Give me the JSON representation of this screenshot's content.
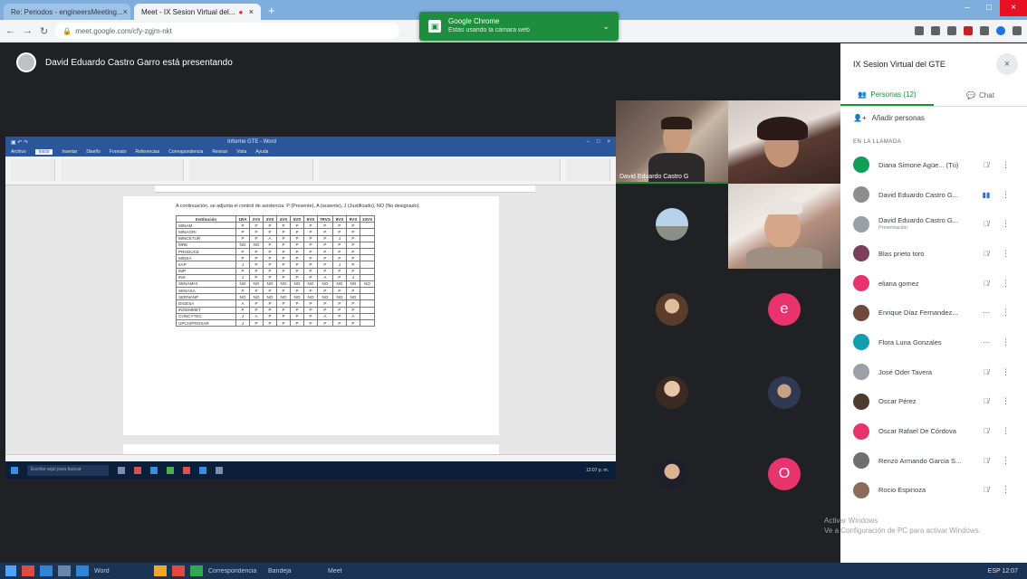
{
  "browser": {
    "tabs": [
      {
        "label": "Re: Periodos - engineersMeeting...",
        "active": false
      },
      {
        "label": "Meet - IX Sesion Virtual del...",
        "active": true
      }
    ],
    "url": "meet.google.com/cfy-zgjm-nkt"
  },
  "toast": {
    "title": "Google Chrome",
    "subtitle": "Estás usando la cámara web"
  },
  "presenter": {
    "text": "David Eduardo Castro Garro está presentando"
  },
  "word": {
    "title": "Informe GTE - Word",
    "tabs": [
      "Archivo",
      "Inicio",
      "Insertar",
      "Diseño",
      "Formato",
      "Referencias",
      "Correspondencia",
      "Revisar",
      "Vista",
      "Ayuda"
    ],
    "paragraph": "A continuación, se adjunta el control de asistencia: P (Presente), A (ausente), J (Justificado), NO (No designado).",
    "columns": [
      "Institución",
      "1RA",
      "2VS",
      "3VS",
      "4VS",
      "5VS",
      "6VS",
      "7RVS",
      "8VS",
      "9VS",
      "10VS"
    ],
    "rows": [
      {
        "name": "MINAM",
        "vals": [
          "P",
          "P",
          "P",
          "P",
          "P",
          "P",
          "P",
          "P",
          "P",
          ""
        ]
      },
      {
        "name": "MINAGRI",
        "vals": [
          "P",
          "P",
          "P",
          "P",
          "P",
          "P",
          "P",
          "P",
          "P",
          ""
        ]
      },
      {
        "name": "MINCETUR",
        "vals": [
          "P",
          "P",
          "A",
          "P",
          "P",
          "P",
          "P",
          "J",
          "P",
          ""
        ]
      },
      {
        "name": "MRE",
        "vals": [
          "NO",
          "NO",
          "P",
          "P",
          "P",
          "P",
          "P",
          "P",
          "P",
          ""
        ]
      },
      {
        "name": "PRODUCE",
        "vals": [
          "P",
          "P",
          "P",
          "P",
          "P",
          "P",
          "P",
          "P",
          "P",
          ""
        ]
      },
      {
        "name": "MINSA",
        "vals": [
          "P",
          "P",
          "P",
          "P",
          "P",
          "P",
          "P",
          "P",
          "P",
          ""
        ]
      },
      {
        "name": "IIAP",
        "vals": [
          "J",
          "P",
          "P",
          "P",
          "P",
          "P",
          "P",
          "J",
          "P",
          ""
        ]
      },
      {
        "name": "IMP",
        "vals": [
          "P",
          "P",
          "P",
          "P",
          "P",
          "P",
          "P",
          "P",
          "P",
          ""
        ]
      },
      {
        "name": "INS",
        "vals": [
          "J",
          "P",
          "P",
          "P",
          "P",
          "P",
          "A",
          "P",
          "J",
          ""
        ]
      },
      {
        "name": "SENAMHI",
        "vals": [
          "NO",
          "NO",
          "NO",
          "NO",
          "NO",
          "NO",
          "NO",
          "NO",
          "NO",
          "NO"
        ]
      },
      {
        "name": "SENASA",
        "vals": [
          "P",
          "P",
          "P",
          "P",
          "P",
          "P",
          "P",
          "P",
          "P",
          ""
        ]
      },
      {
        "name": "SERNANP",
        "vals": [
          "NO",
          "NO",
          "NO",
          "NO",
          "NO",
          "NO",
          "NO",
          "NO",
          "NO",
          ""
        ]
      },
      {
        "name": "DIGESA",
        "vals": [
          "A",
          "P",
          "P",
          "P",
          "P",
          "P",
          "P",
          "P",
          "P",
          ""
        ]
      },
      {
        "name": "INGEMMET",
        "vals": [
          "P",
          "P",
          "P",
          "P",
          "P",
          "P",
          "P",
          "P",
          "P",
          ""
        ]
      },
      {
        "name": "CONCYTEC",
        "vals": [
          "J",
          "A",
          "P",
          "P",
          "P",
          "P",
          "A",
          "P",
          "A",
          ""
        ]
      },
      {
        "name": "UPCH/PROSAR",
        "vals": [
          "J",
          "P",
          "P",
          "P",
          "P",
          "P",
          "P",
          "P",
          "P",
          ""
        ]
      }
    ],
    "popup_text": "Guardar este documento en OneDrive?",
    "popup_btn": "Guardar ahora",
    "taskbar_search": "Escribe aquí para buscar",
    "clock": "12:07 p. m."
  },
  "tiles": {
    "speaker_label": "David Eduardo Castro G"
  },
  "panel": {
    "title": "IX Sesion Virtual del GTE",
    "tab_people": "Personas (12)",
    "tab_chat": "Chat",
    "add_people": "Añadir personas",
    "section": "EN LA LLAMADA",
    "participants": [
      {
        "name": "Diana Simone Agüe... (Tú)",
        "sub": "",
        "color": "#0f9d58",
        "mic": "off"
      },
      {
        "name": "David Eduardo Castro G...",
        "sub": "",
        "color": "#8d8d8d",
        "mic": "on"
      },
      {
        "name": "David Eduardo Castro G...",
        "sub": "Presentación",
        "color": "#9aa0a6",
        "mic": "off"
      },
      {
        "name": "Blas prieto toro",
        "sub": "",
        "color": "#7b3f5a",
        "mic": "off"
      },
      {
        "name": "eliana gomez",
        "sub": "",
        "color": "#e8336d",
        "mic": "off"
      },
      {
        "name": "Enrique Díaz Fernandez...",
        "sub": "",
        "color": "#6d4a3a",
        "mic": "muted"
      },
      {
        "name": "Flora Luna Gonzales",
        "sub": "",
        "color": "#129eaf",
        "mic": "muted"
      },
      {
        "name": "José Oder Tavera",
        "sub": "",
        "color": "#9aa0a6",
        "mic": "off"
      },
      {
        "name": "Oscar Pérez",
        "sub": "",
        "color": "#4e3b2f",
        "mic": "off"
      },
      {
        "name": "Oscar Rafael De Córdova",
        "sub": "",
        "color": "#e8336d",
        "mic": "off"
      },
      {
        "name": "Renzo Armando Garcia S...",
        "sub": "",
        "color": "#6f6f6f",
        "mic": "off"
      },
      {
        "name": "Rocio Espinoza",
        "sub": "",
        "color": "#8b6c5c",
        "mic": "off"
      }
    ]
  },
  "watermark": {
    "line1": "Activar Windows",
    "line2": "Ve a Configuración de PC para activar Windows."
  },
  "os_taskbar": {
    "labels": [
      "Word",
      "Correspondencia",
      "Bandeja",
      "Meet"
    ],
    "tray": "ESP 12:07"
  }
}
